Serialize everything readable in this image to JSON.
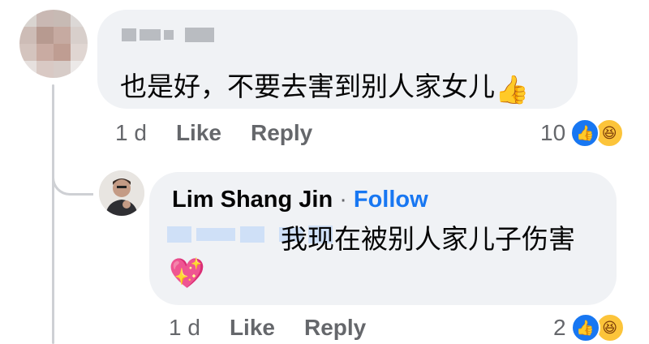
{
  "comment": {
    "text": "也是好，不要去害到别人家女儿",
    "emoji": "👍",
    "time": "1 d",
    "like_label": "Like",
    "reply_label": "Reply",
    "reaction_count": "10"
  },
  "reply": {
    "author": "Lim Shang Jin",
    "separator": "·",
    "follow_label": "Follow",
    "text": "我现在被别人家儿子伤害",
    "emoji": "💖",
    "time": "1 d",
    "like_label": "Like",
    "reply_label": "Reply",
    "reaction_count": "2"
  },
  "colors": {
    "accent": "#1877f2",
    "bubble": "#f0f2f5",
    "meta_text": "#65676b",
    "haha": "#fcc43a"
  },
  "icons": [
    "like-reaction-icon",
    "haha-reaction-icon",
    "thumbs-up-emoji",
    "sparkling-heart-emoji"
  ]
}
